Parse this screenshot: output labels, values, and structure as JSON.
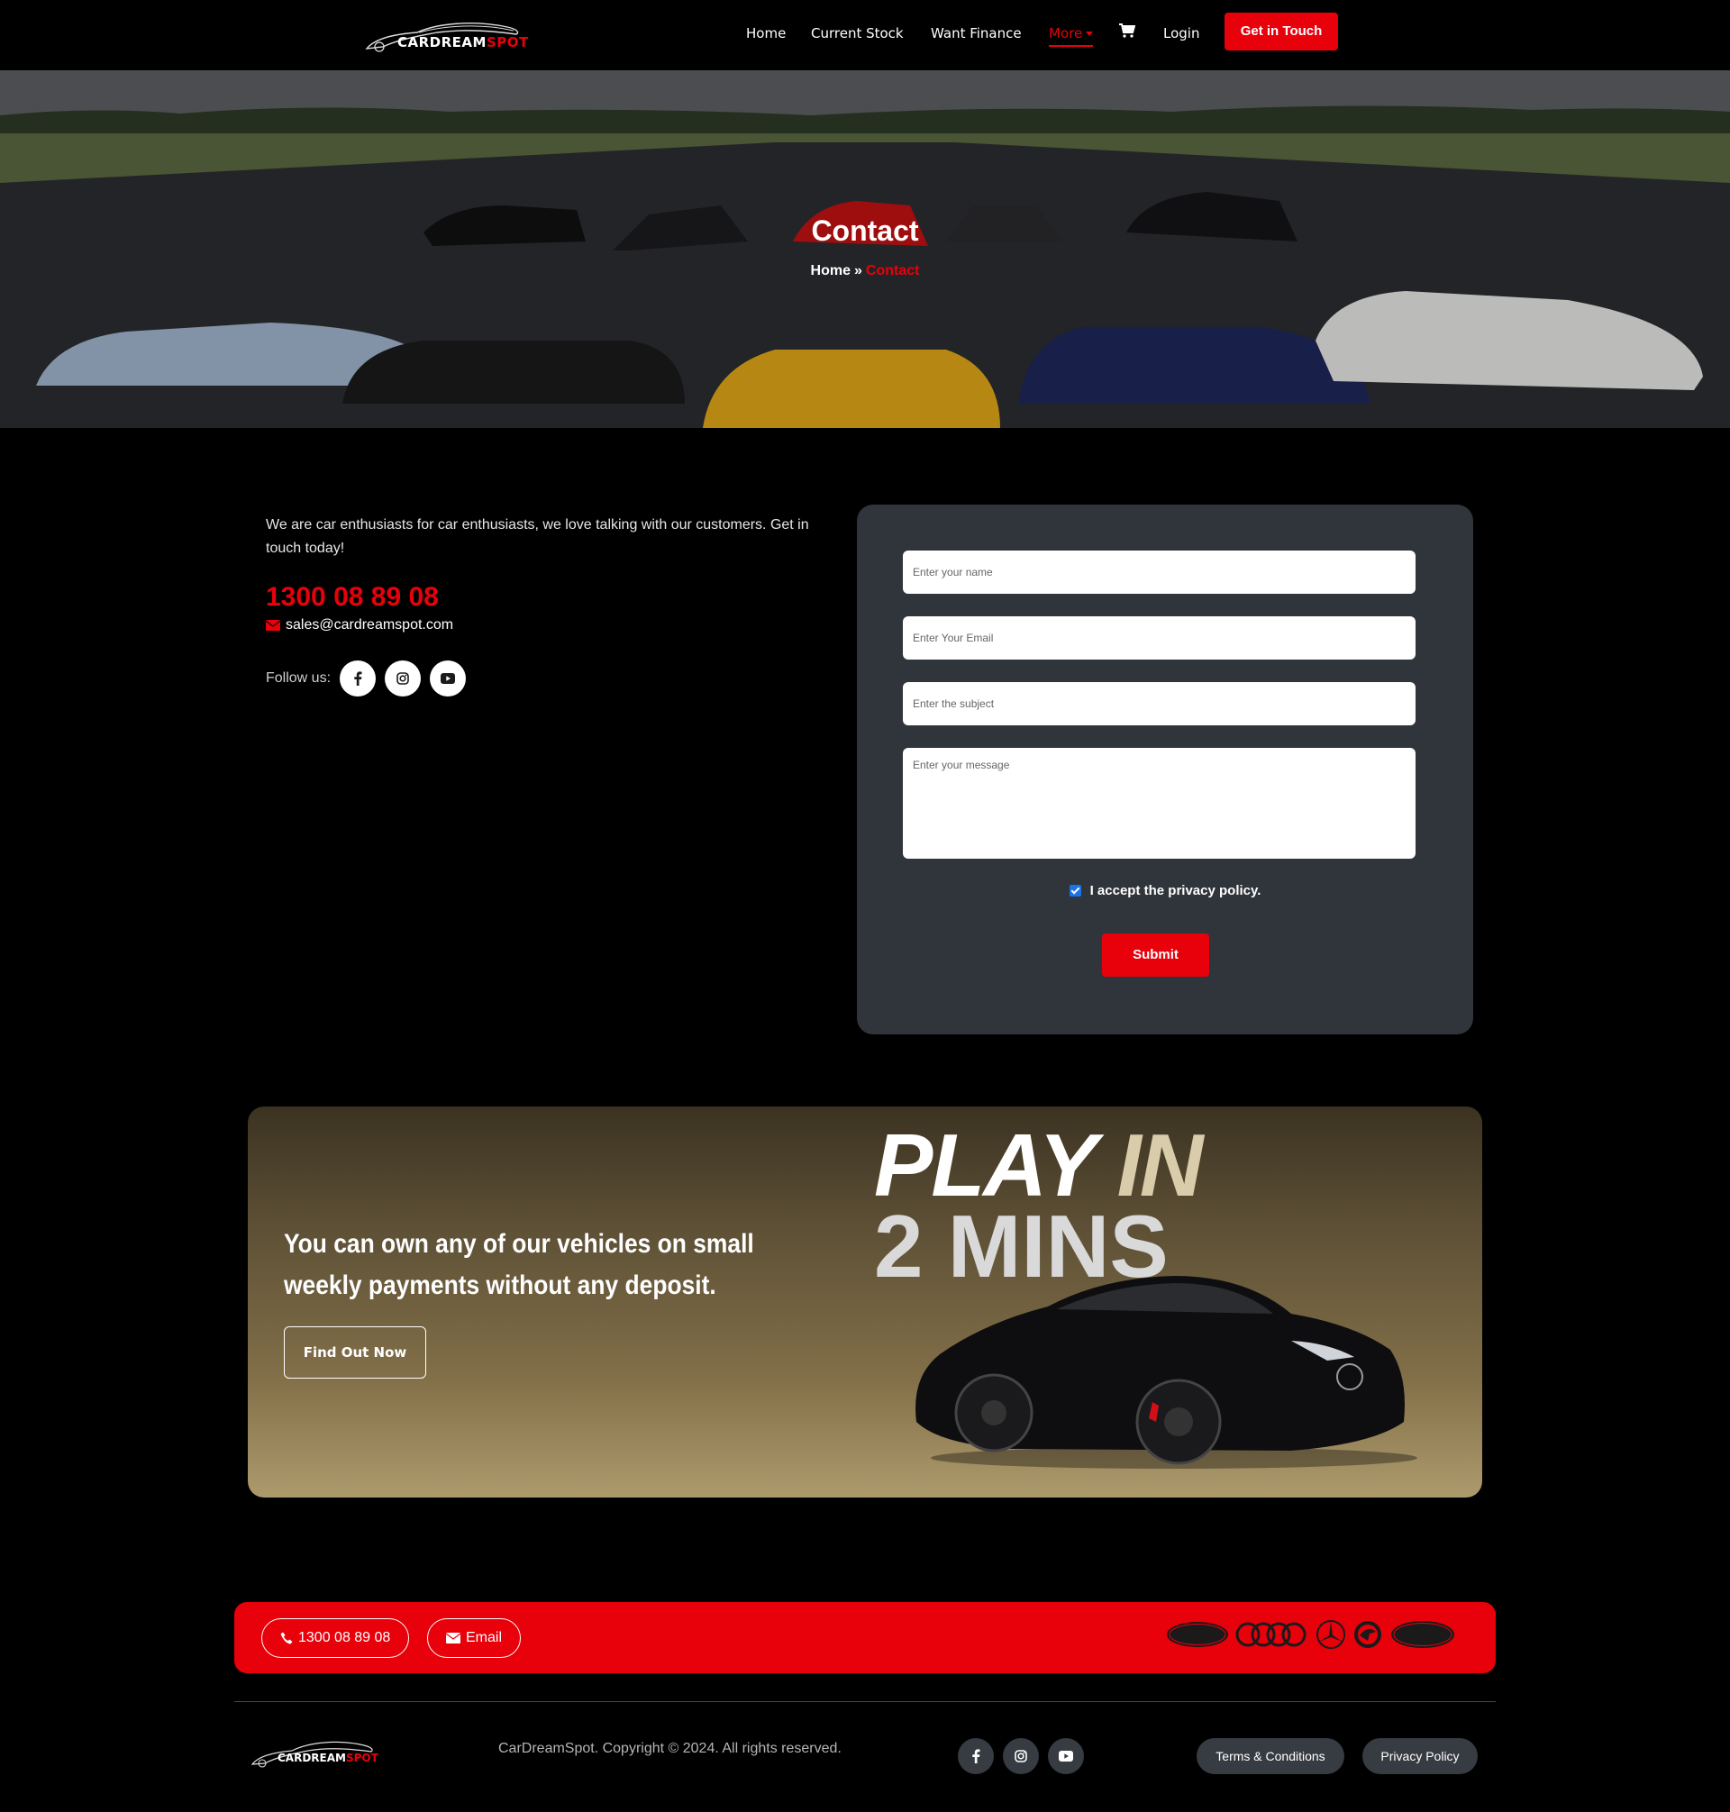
{
  "nav": {
    "logo_part1": "CARDREAM",
    "logo_part2": "SPOT",
    "items": [
      "Home",
      "Current Stock",
      "Want Finance",
      "More",
      "Login"
    ],
    "cta": "Get in Touch"
  },
  "hero": {
    "title": "Contact",
    "breadcrumb_home": "Home",
    "breadcrumb_sep": "»",
    "breadcrumb_current": "Contact"
  },
  "contact": {
    "intro": "We are car enthusiasts for car enthusiasts, we love talking with our customers. Get in touch today!",
    "phone": "1300 08 89 08",
    "email": "sales@cardreamspot.com",
    "follow_label": "Follow us:"
  },
  "form": {
    "name_placeholder": "Enter your name",
    "email_placeholder": "Enter Your Email",
    "subject_placeholder": "Enter the subject",
    "message_placeholder": "Enter your message",
    "consent": "I accept the privacy policy.",
    "consent_checked": true,
    "submit": "Submit"
  },
  "promo": {
    "text": "You can own any of our vehicles on small weekly payments without any deposit.",
    "button": "Find Out Now",
    "play": "PLAY",
    "in": "IN",
    "mins": "2 MINS"
  },
  "footer": {
    "phone_pill": "1300 08 89 08",
    "email_pill": "Email",
    "brands": [
      "ford-logo",
      "audi-logo",
      "mercedes-logo",
      "skoda-logo",
      "land-rover-logo"
    ],
    "logo_part1": "CARDREAM",
    "logo_part2": "SPOT",
    "copyright": "CarDreamSpot. Copyright © 2024. All rights reserved.",
    "terms": "Terms & Conditions",
    "privacy": "Privacy Policy"
  },
  "colors": {
    "accent": "#e8000b",
    "card": "#30343b",
    "footer_pill": "#373b42"
  }
}
